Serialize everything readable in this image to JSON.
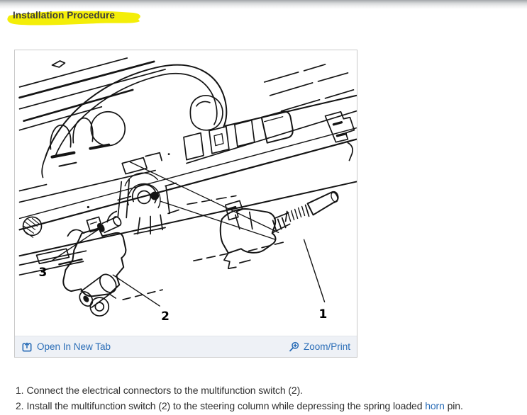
{
  "page": {
    "title": "Installation Procedure"
  },
  "figure": {
    "description": "steering-column-multifunction-switch-diagram",
    "callouts": [
      "1",
      "2",
      "3"
    ],
    "toolbar": {
      "open_in_new_tab": "Open In New Tab",
      "zoom_print": "Zoom/Print"
    }
  },
  "instructions": [
    {
      "number": "1.",
      "text": "Connect the electrical connectors to the multifunction switch (2)."
    },
    {
      "number": "2.",
      "text_before": "Install the multifunction switch (2) to the steering column while depressing the spring loaded ",
      "link_text": "horn",
      "text_after": " pin."
    }
  ],
  "colors": {
    "link_blue": "#2a6db7",
    "highlight_yellow": "#f4ee08",
    "toolbar_background": "#eef1f6"
  }
}
